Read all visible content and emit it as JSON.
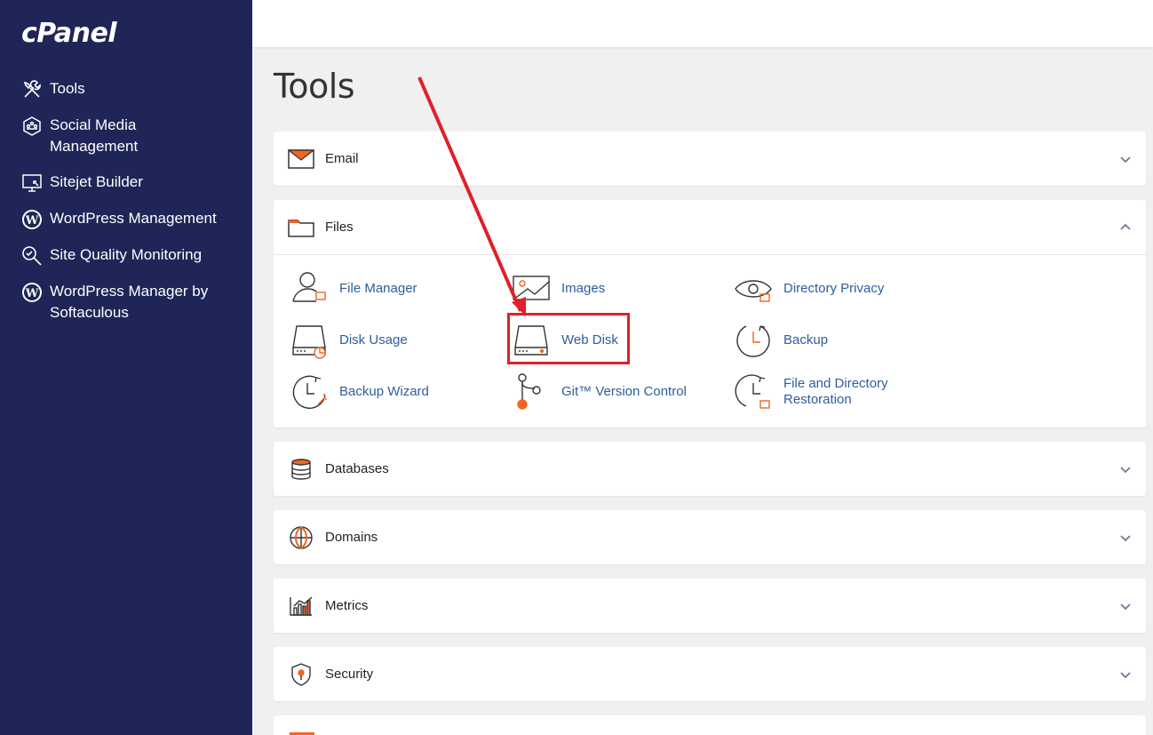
{
  "brand": {
    "logo": "cPanel"
  },
  "sidebar": {
    "items": [
      {
        "label": "Tools",
        "icon": "tools-icon"
      },
      {
        "label": "Social Media\nManagement",
        "icon": "social-media-icon"
      },
      {
        "label": "Sitejet Builder",
        "icon": "sitejet-icon"
      },
      {
        "label": "WordPress Management",
        "icon": "wordpress-icon"
      },
      {
        "label": "Site Quality Monitoring",
        "icon": "magnifier-icon"
      },
      {
        "label": "WordPress Manager by\nSoftaculous",
        "icon": "wordpress-icon"
      }
    ]
  },
  "main": {
    "title": "Tools",
    "sections": {
      "email": {
        "label": "Email"
      },
      "files": {
        "label": "Files",
        "tools": [
          {
            "label": "File Manager"
          },
          {
            "label": "Images"
          },
          {
            "label": "Directory Privacy"
          },
          {
            "label": "Disk Usage"
          },
          {
            "label": "Web Disk"
          },
          {
            "label": "Backup"
          },
          {
            "label": "Backup Wizard"
          },
          {
            "label": "Git™ Version Control"
          },
          {
            "label": "File and Directory\nRestoration"
          }
        ]
      },
      "databases": {
        "label": "Databases"
      },
      "domains": {
        "label": "Domains"
      },
      "metrics": {
        "label": "Metrics"
      },
      "security": {
        "label": "Security"
      }
    }
  },
  "colors": {
    "sidebar_bg": "#1f2556",
    "accent_orange": "#f26522",
    "link_blue": "#2e5d9e",
    "highlight_red": "#e0202a"
  }
}
